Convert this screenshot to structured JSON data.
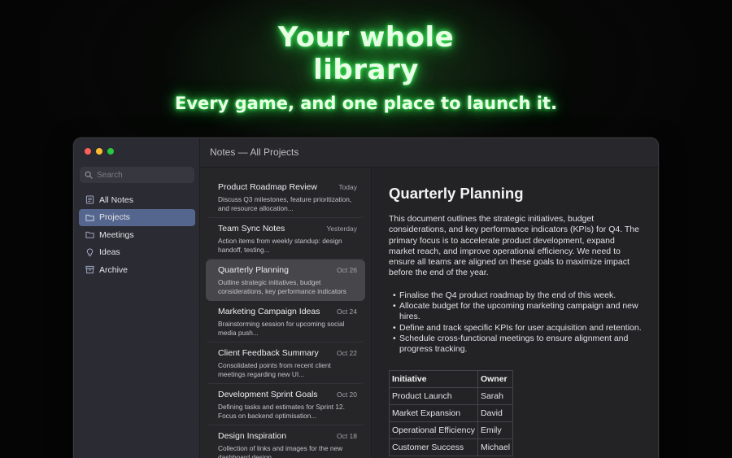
{
  "hero": {
    "title_line1": "Your whole",
    "title_line2": "library",
    "subtitle": "Every game, and one place to launch it."
  },
  "window": {
    "title": "Notes — All Projects"
  },
  "sidebar": {
    "search_placeholder": "Search",
    "items": [
      {
        "label": "All Notes",
        "icon": "notes-icon"
      },
      {
        "label": "Projects",
        "icon": "folder-icon",
        "active": true
      },
      {
        "label": "Meetings",
        "icon": "folder-icon"
      },
      {
        "label": "Ideas",
        "icon": "lightbulb-icon"
      },
      {
        "label": "Archive",
        "icon": "archive-icon"
      }
    ]
  },
  "notes": [
    {
      "title": "Product Roadmap Review",
      "date": "Today",
      "preview": "Discuss Q3 milestones, feature prioritization, and resource allocation..."
    },
    {
      "title": "Team Sync Notes",
      "date": "Yesterday",
      "preview": "Action items from weekly standup: design handoff, testing..."
    },
    {
      "title": "Quarterly Planning",
      "date": "Oct 26",
      "preview": "Outline strategic initiatives, budget considerations, key performance indicators for",
      "active": true
    },
    {
      "title": "Marketing Campaign Ideas",
      "date": "Oct 24",
      "preview": "Brainstorming session for upcoming social media push..."
    },
    {
      "title": "Client Feedback Summary",
      "date": "Oct 22",
      "preview": "Consolidated points from recent client meetings regarding new UI..."
    },
    {
      "title": "Development Sprint Goals",
      "date": "Oct 20",
      "preview": "Defining tasks and estimates for Sprint 12. Focus on backend optimisation..."
    },
    {
      "title": "Design Inspiration",
      "date": "Oct 18",
      "preview": "Collection of links and images for the new dashboard design..."
    }
  ],
  "document": {
    "title": "Quarterly Planning",
    "body": "This document outlines the strategic initiatives, budget considerations, and key performance indicators (KPIs) for Q4. The primary focus is to accelerate product development, expand market reach, and improve operational efficiency. We need to ensure all teams are aligned on these goals to maximize impact before the end of the year.",
    "bullets": [
      "Finalise the Q4 product roadmap by the end of this week.",
      "Allocate budget for the upcoming marketing campaign and new hires.",
      "Define and track specific KPIs for user acquisition and retention.",
      "Schedule cross-functional meetings to ensure alignment and progress tracking."
    ],
    "table": {
      "headers": [
        "Initiative",
        "Owner"
      ],
      "rows": [
        [
          "Product Launch",
          "Sarah"
        ],
        [
          "Market Expansion",
          "David"
        ],
        [
          "Operational Efficiency",
          "Emily"
        ],
        [
          "Customer Success",
          "Michael"
        ]
      ]
    }
  }
}
